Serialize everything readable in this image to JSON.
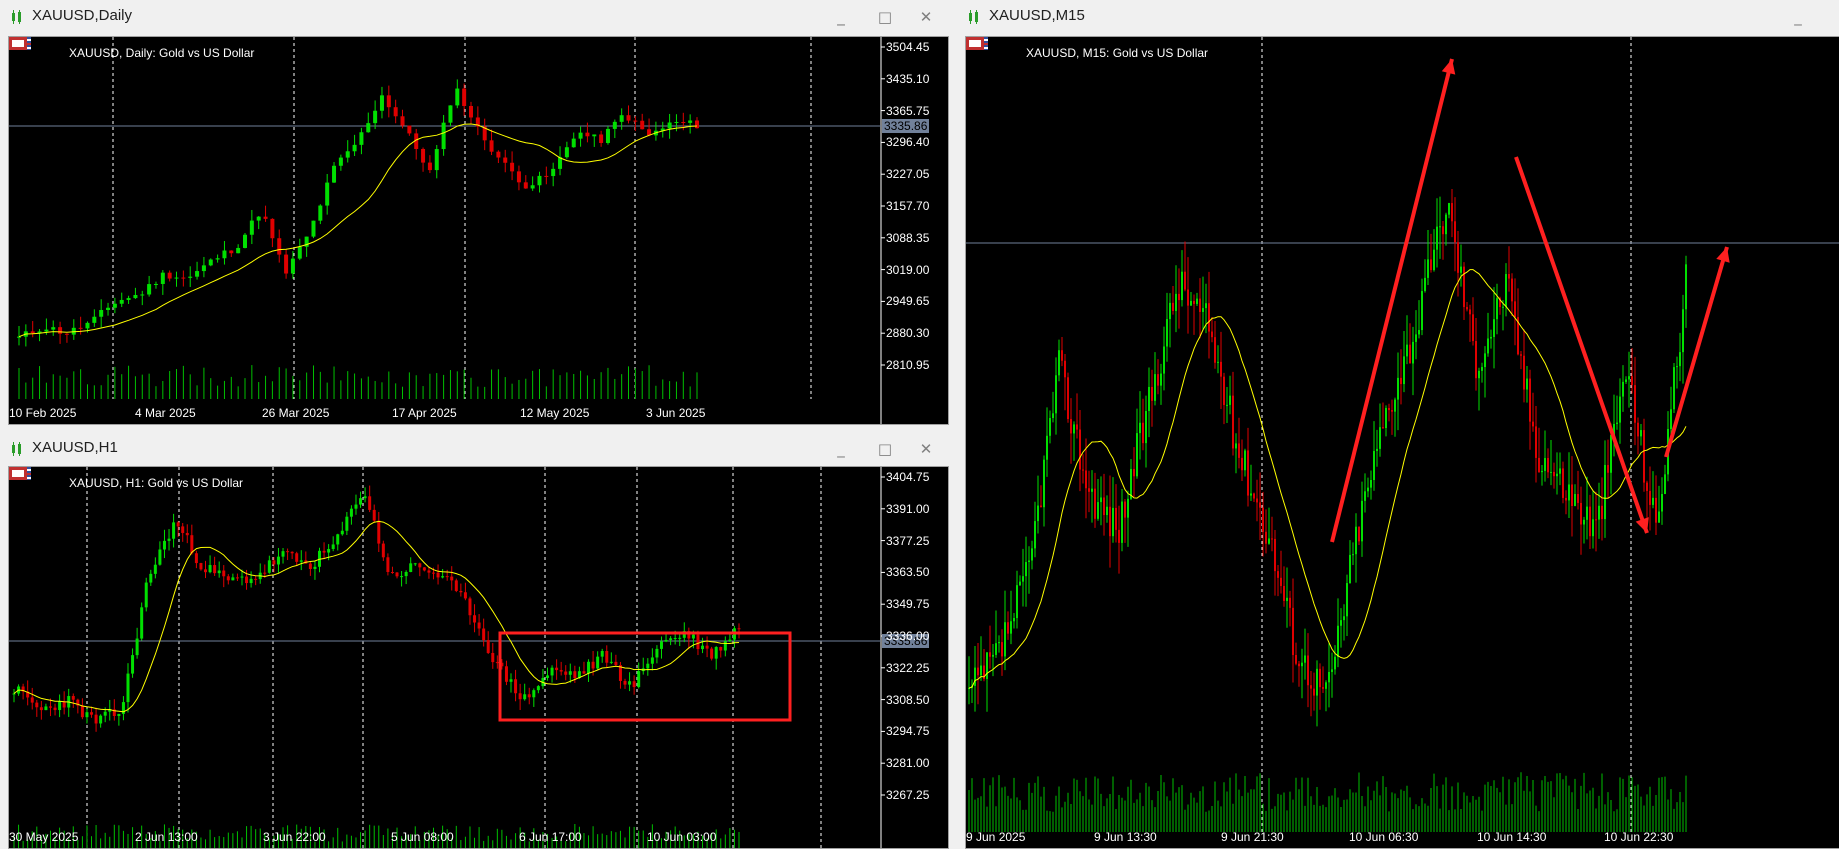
{
  "windows": [
    {
      "id": "daily",
      "title": "XAUUSD,Daily",
      "chart_label": "XAUUSD, Daily:  Gold vs US Dollar",
      "current_price": "3335.86",
      "price_ticks": [
        "3504.45",
        "3435.10",
        "3365.75",
        "3296.40",
        "3227.05",
        "3157.70",
        "3088.35",
        "3019.00",
        "2949.65",
        "2880.30",
        "2810.95"
      ],
      "time_ticks": [
        "10 Feb 2025",
        "4 Mar 2025",
        "26 Mar 2025",
        "17 Apr 2025",
        "12 May 2025",
        "3 Jun 2025"
      ]
    },
    {
      "id": "h1",
      "title": "XAUUSD,H1",
      "chart_label": "XAUUSD, H1:  Gold vs US Dollar",
      "current_price": "3335.86",
      "price_ticks": [
        "3404.75",
        "3391.00",
        "3377.25",
        "3363.50",
        "3349.75",
        "3336.00",
        "3322.25",
        "3308.50",
        "3294.75",
        "3281.00",
        "3267.25"
      ],
      "time_ticks": [
        "30 May 2025",
        "2 Jun 13:00",
        "3 Jun 22:00",
        "5 Jun 08:00",
        "6 Jun 17:00",
        "10 Jun 03:00"
      ]
    },
    {
      "id": "m15",
      "title": "XAUUSD,M15",
      "chart_label": "XAUUSD, M15:  Gold vs US Dollar",
      "time_ticks": [
        "9 Jun 2025",
        "9 Jun 13:30",
        "9 Jun 21:30",
        "10 Jun 06:30",
        "10 Jun 14:30",
        "10 Jun 22:30"
      ]
    }
  ],
  "colors": {
    "bull": "#00e000",
    "bear": "#e00000",
    "ma": "#ffff00",
    "volume": "#00c000",
    "grid": "#ffffff",
    "annotation": "#ff2020",
    "price_line": "#71819a"
  },
  "controls": {
    "minimize": "_",
    "maximize": "□",
    "close": "✕"
  }
}
